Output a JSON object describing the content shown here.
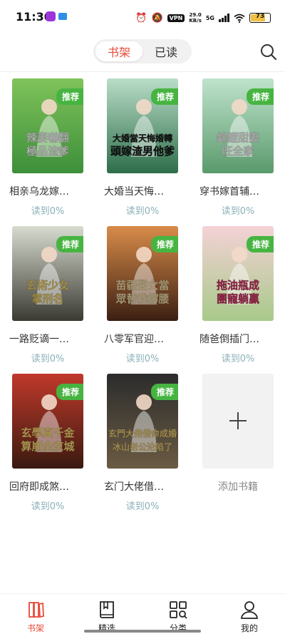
{
  "status_bar": {
    "time": "11:30",
    "vpn": "VPN",
    "speed_value": "29.0",
    "speed_unit": "KB/s",
    "network": "5G",
    "battery": "73"
  },
  "header": {
    "tabs": [
      {
        "label": "书架",
        "active": true
      },
      {
        "label": "已读",
        "active": false
      }
    ],
    "search_icon": "search-icon"
  },
  "books": [
    {
      "title": "相亲乌龙嫁…",
      "progress": "读到0%",
      "badge": "推荐",
      "cover_text": "辣妻嚇翻極品渣爹",
      "cover_colors": [
        "#7fc35a",
        "#3d8f3a"
      ],
      "cover_text_color": "#ffffff"
    },
    {
      "title": "大婚当天悔…",
      "progress": "读到0%",
      "badge": "推荐",
      "cover_text": "大婚當天悔婚轉頭嫁渣男他爹",
      "cover_colors": [
        "#b9ddc8",
        "#2e6e4a"
      ],
      "cover_text_color": "#1a1a1a"
    },
    {
      "title": "穿书嫁首辅…",
      "progress": "读到0%",
      "badge": "推荐",
      "cover_text": "錦鯉甜妻旺全家",
      "cover_colors": [
        "#bfe3cc",
        "#5a9a6c"
      ],
      "cover_text_color": "#ffffff"
    },
    {
      "title": "一路贬谪一…",
      "progress": "读到0%",
      "badge": "推荐",
      "cover_text": "玄術少女掌刑名",
      "cover_colors": [
        "#d8dcd0",
        "#3a3a32"
      ],
      "cover_text_color": "#f2d36b"
    },
    {
      "title": "八零军官迎…",
      "progress": "读到0%",
      "badge": "推荐",
      "cover_text": "苗疆醫女當眾替我撐腰",
      "cover_colors": [
        "#d98c4a",
        "#3b1f12"
      ],
      "cover_text_color": "#f7e3b0"
    },
    {
      "title": "随爸倒插门…",
      "progress": "读到0%",
      "badge": "推荐",
      "cover_text": "拖油瓶成團寵躺贏",
      "cover_colors": [
        "#f4d2d6",
        "#a8c98a"
      ],
      "cover_text_color": "#d62f66"
    },
    {
      "title": "回府即成煞…",
      "progress": "读到0%",
      "badge": "推荐",
      "cover_text": "玄學真千金算崩全京城",
      "cover_colors": [
        "#c0392b",
        "#3a1a10"
      ],
      "cover_text_color": "#ffe07a"
    },
    {
      "title": "玄门大佬借…",
      "progress": "读到0%",
      "badge": "推荐",
      "cover_text": "玄門大佬借命成婚冰山老公沦陷了",
      "cover_colors": [
        "#2c2c2c",
        "#6a5b43"
      ],
      "cover_text_color": "#f3d27a"
    }
  ],
  "add_book": {
    "label": "添加书籍"
  },
  "bottom_nav": [
    {
      "label": "书架",
      "icon": "bookshelf-icon",
      "active": true
    },
    {
      "label": "精选",
      "icon": "book-icon",
      "active": false
    },
    {
      "label": "分类",
      "icon": "category-grid-icon",
      "active": false
    },
    {
      "label": "我的",
      "icon": "profile-icon",
      "active": false
    }
  ],
  "colors": {
    "accent": "#e84a3a",
    "badge": "#47b441",
    "progress": "#8ab0b8"
  }
}
